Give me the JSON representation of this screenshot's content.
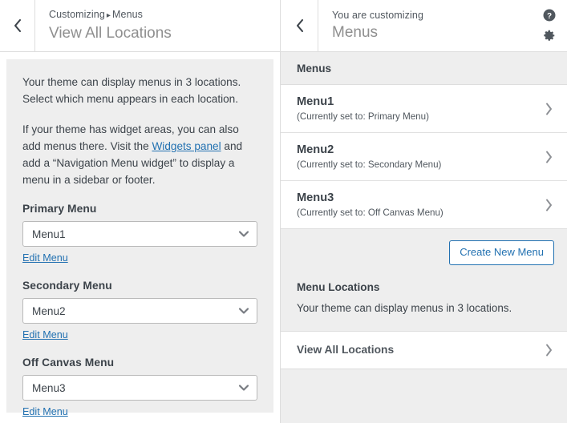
{
  "left_panel": {
    "back_icon": "chevron-left-icon",
    "breadcrumb_root": "Customizing",
    "breadcrumb_sep": "▸",
    "breadcrumb_current": "Menus",
    "title": "View All Locations",
    "paragraph_1": "Your theme can display menus in 3 locations. Select which menu appears in each location.",
    "paragraph_2_pre": "If your theme has widget areas, you can also add menus there. Visit the ",
    "paragraph_2_link": "Widgets panel",
    "paragraph_2_post": " and add a “Navigation Menu widget” to display a menu in a sidebar or footer.",
    "fields": [
      {
        "label": "Primary Menu",
        "value": "Menu1",
        "edit_label": "Edit Menu",
        "arrow_icon": "chevron-down-icon"
      },
      {
        "label": "Secondary Menu",
        "value": "Menu2",
        "edit_label": "Edit Menu",
        "arrow_icon": "chevron-down-icon"
      },
      {
        "label": "Off Canvas Menu",
        "value": "Menu3",
        "edit_label": "Edit Menu",
        "arrow_icon": "chevron-down-icon"
      }
    ]
  },
  "right_panel": {
    "back_icon": "chevron-left-icon",
    "eyebrow": "You are customizing",
    "title": "Menus",
    "help_icon": "help-circle-icon",
    "gear_icon": "gear-icon",
    "section_title": "Menus",
    "menus": [
      {
        "name": "Menu1",
        "assignment": "(Currently set to: Primary Menu)",
        "chevron_icon": "chevron-right-icon"
      },
      {
        "name": "Menu2",
        "assignment": "(Currently set to: Secondary Menu)",
        "chevron_icon": "chevron-right-icon"
      },
      {
        "name": "Menu3",
        "assignment": "(Currently set to: Off Canvas Menu)",
        "chevron_icon": "chevron-right-icon"
      }
    ],
    "create_button": "Create New Menu",
    "locations_title": "Menu Locations",
    "locations_desc": "Your theme can display menus in 3 locations.",
    "view_all_label": "View All Locations",
    "view_all_chevron_icon": "chevron-right-icon"
  },
  "colors": {
    "link": "#2271b1",
    "text": "#3c434a",
    "muted": "#50575e",
    "panel_bg": "#eeeeee",
    "border": "#dddddd"
  }
}
